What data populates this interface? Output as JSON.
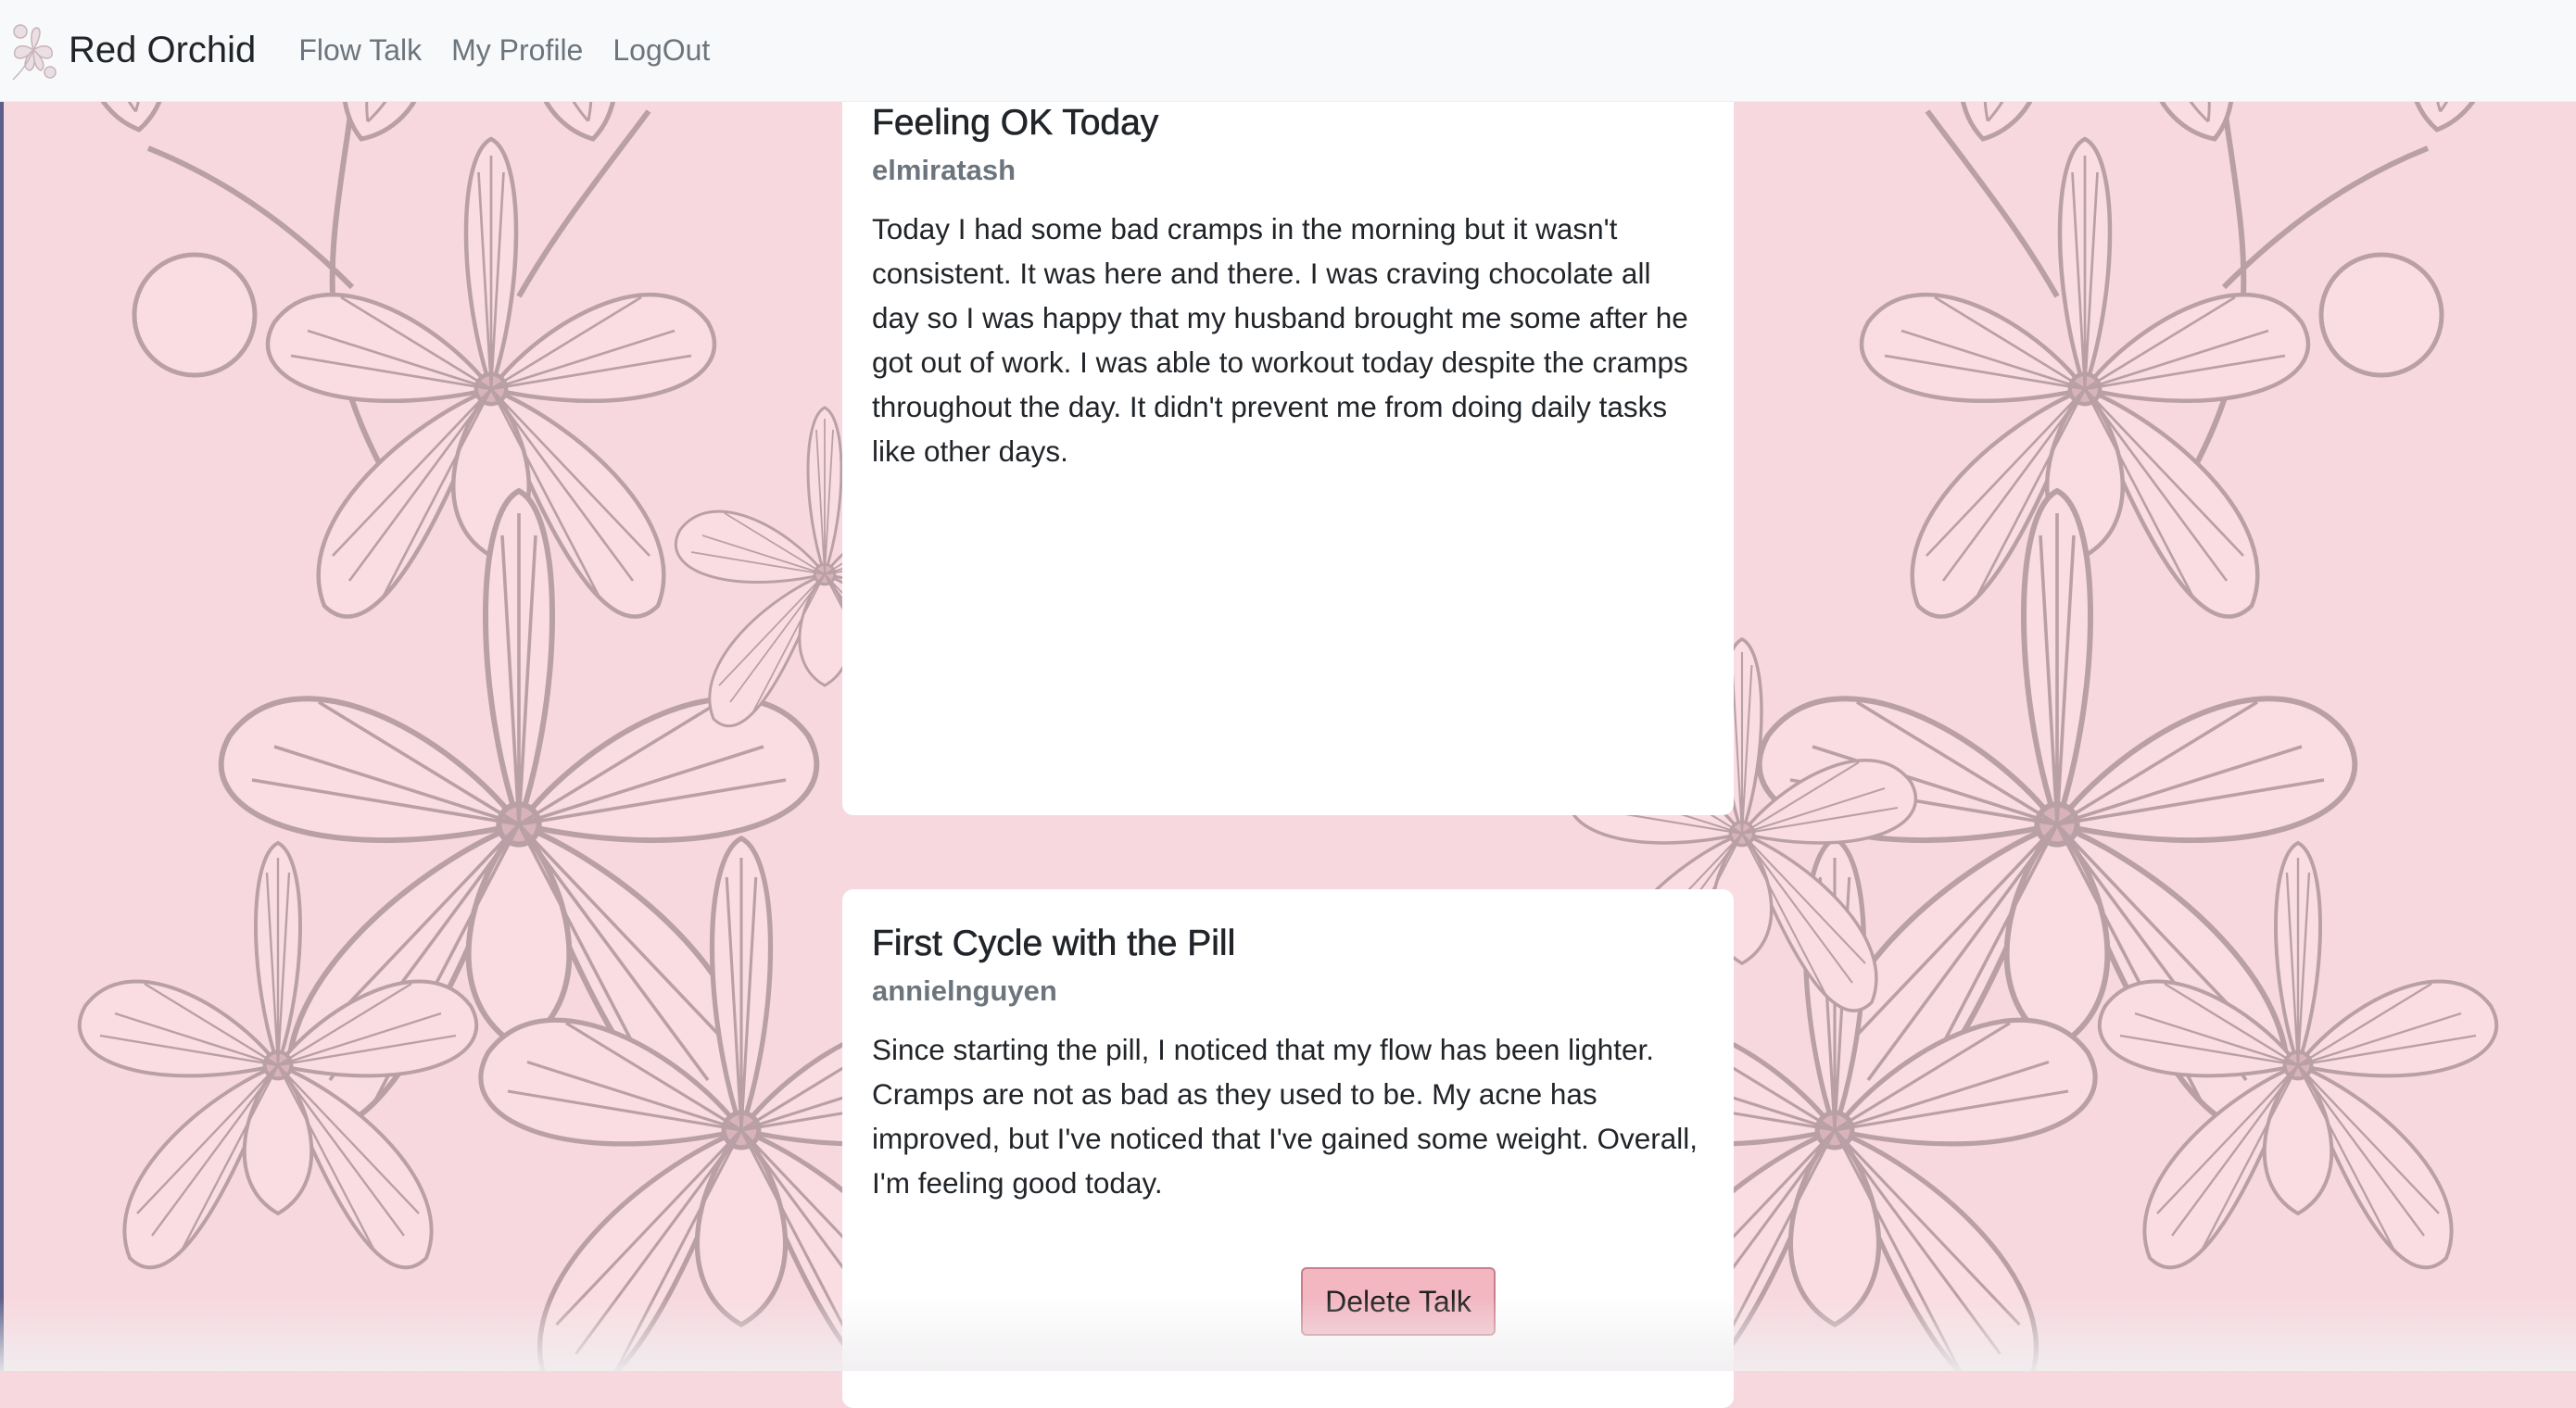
{
  "navbar": {
    "brand": "Red Orchid",
    "links": [
      "Flow Talk",
      "My Profile",
      "LogOut"
    ]
  },
  "posts": [
    {
      "title": "Feeling OK Today",
      "author": "elmiratash",
      "body": "Today I had some bad cramps in the morning but it wasn't consistent. It was here and there. I was craving chocolate all day so I was happy that my husband brought me some after he got out of work. I was able to workout today despite the cramps throughout the day. It didn't prevent me from doing daily tasks like other days."
    },
    {
      "title": "First Cycle with the Pill",
      "author": "annielnguyen",
      "body": "Since starting the pill, I noticed that my flow has been lighter. Cramps are not as bad as they used to be. My acne has improved, but I've noticed that I've gained some weight. Overall, I'm feeling good today.",
      "delete_label": "Delete Talk"
    }
  ],
  "colors": {
    "page_background": "#f7d8de",
    "petal_line": "#b9a0a6",
    "petal_fill": "#fadde2",
    "delete_button": "#f2b7c1",
    "navbar": "#f8f9fa"
  },
  "icons": {
    "logo": "orchid-logo-icon",
    "background": "orchid-pattern"
  }
}
